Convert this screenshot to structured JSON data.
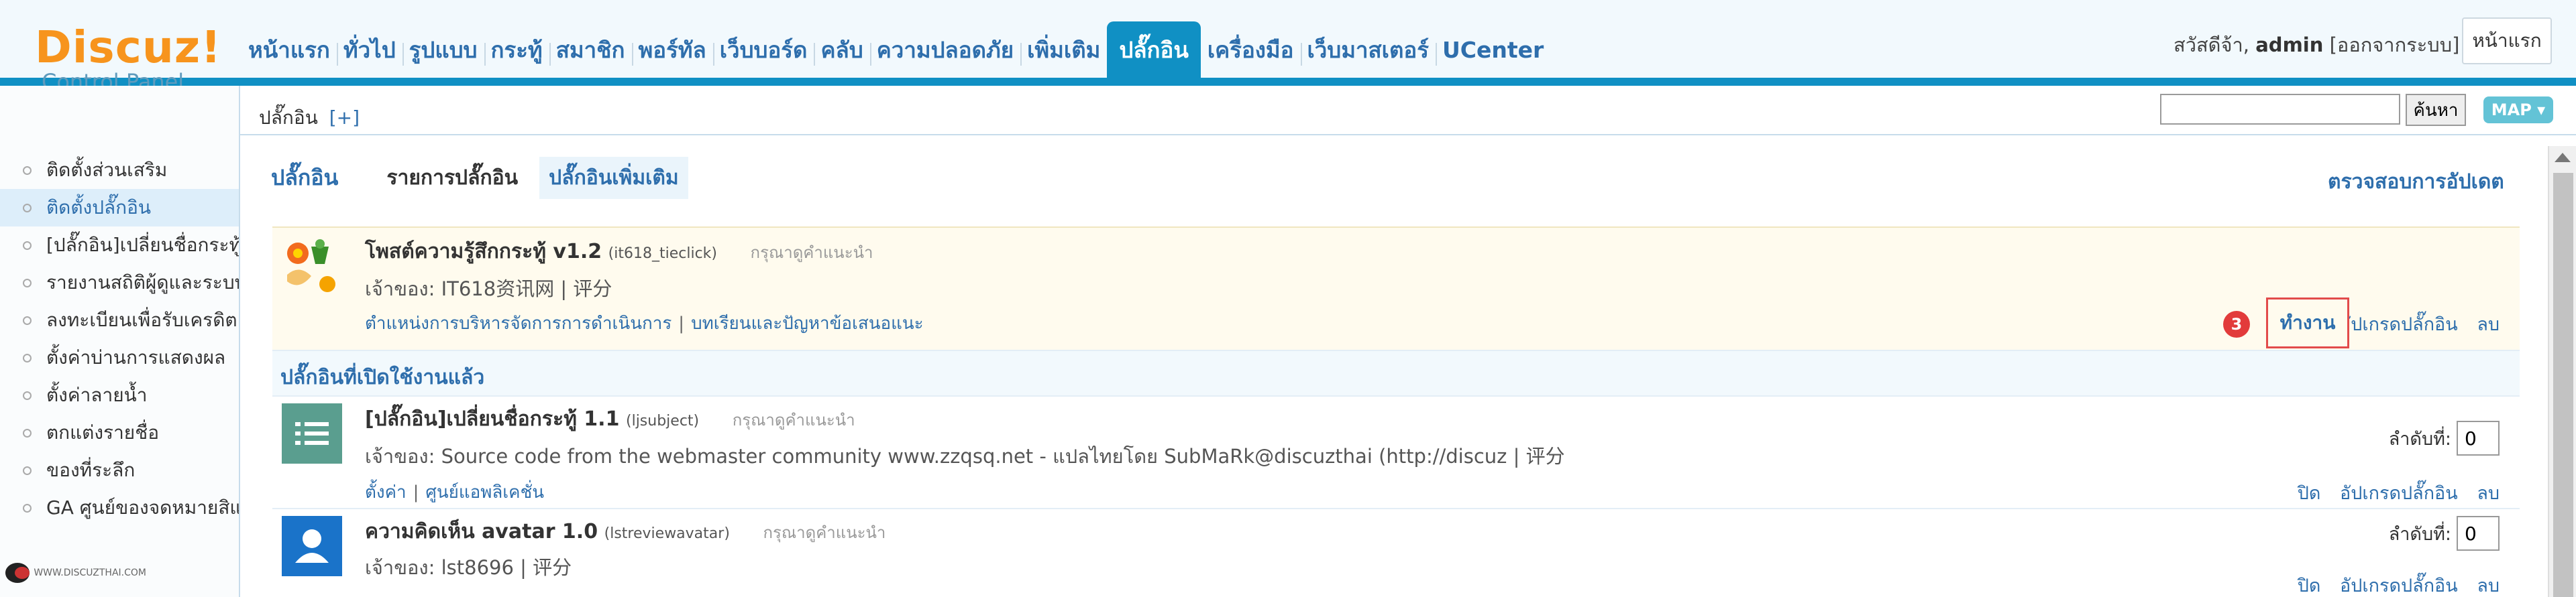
{
  "logo": {
    "line1": "Discuz!",
    "line2": "Control Panel"
  },
  "topnav": [
    {
      "label": "หน้าแรก"
    },
    {
      "label": "ทั่วไป"
    },
    {
      "label": "รูปแบบ"
    },
    {
      "label": "กระทู้"
    },
    {
      "label": "สมาชิก"
    },
    {
      "label": "พอร์ทัล"
    },
    {
      "label": "เว็บบอร์ด"
    },
    {
      "label": "คลับ"
    },
    {
      "label": "ความปลอดภัย"
    },
    {
      "label": "เพิ่มเติม"
    },
    {
      "label": "ปลั๊กอิน",
      "active": true
    },
    {
      "label": "เครื่องมือ"
    },
    {
      "label": "เว็บมาสเตอร์"
    },
    {
      "label": "UCenter"
    }
  ],
  "user": {
    "greeting": "สวัสดีจ้า,",
    "name": "admin",
    "logout": "[ออกจากระบบ]",
    "home_button": "หน้าแรก"
  },
  "breadcrumb": {
    "label": "ปลั๊กอิน",
    "plus": "[+]"
  },
  "search": {
    "button": "ค้นหา",
    "map": "MAP ▾"
  },
  "sidebar": {
    "items": [
      {
        "label": "ติดตั้งส่วนเสริม"
      },
      {
        "label": "ติดตั้งปลั๊กอิน",
        "active": true
      },
      {
        "label": "[ปลั๊กอิน]เปลี่ยนชื่อกระทู้"
      },
      {
        "label": "รายงานสถิติผู้ดูและระบบ"
      },
      {
        "label": "ลงทะเบียนเพื่อรับเครดิต"
      },
      {
        "label": "ตั้งค่าบ่านการแสดงผล"
      },
      {
        "label": "ตั้งค่าลายน้ำ"
      },
      {
        "label": "ตกแต่งรายชื่อ"
      },
      {
        "label": "ของที่ระลึก"
      },
      {
        "label": "GA ศูนย์ของจดหมายสิแนะ"
      }
    ],
    "footer": "WWW.DISCUZTHAI.COM"
  },
  "main": {
    "title": "ปลั๊กอิน",
    "tabs": [
      {
        "label": "รายการปลั๊กอิน"
      },
      {
        "label": "ปลั๊กอินเพิ่มเติม",
        "active": true
      }
    ],
    "check_update": "ตรวจสอบการอัปเดต",
    "section_enabled": "ปลั๊กอินที่เปิดใช้งานแล้ว",
    "plugins": [
      {
        "name": "โพสต์ความรู้สึกกระทู้ v1.2",
        "id": "(it618_tieclick)",
        "note": "กรุณาดูคำแนะนำ",
        "owner": "เจ้าของ: IT618资讯网 | 评分",
        "links": [
          "ตำแหน่งการบริหารจัดการการดำเนินการ",
          "บทเรียนและปัญหาข้อเสนอแนะ"
        ],
        "actions": [
          "ทำงาน",
          "อัปเกรดปลั๊กอิน",
          "ลบ"
        ],
        "badge": "3"
      },
      {
        "name": "[ปลั๊กอิน]เปลี่ยนชื่อกระทู้ 1.1",
        "id": "(ljsubject)",
        "note": "กรุณาดูคำแนะนำ",
        "owner": "เจ้าของ: Source code from the webmaster community www.zzqsq.net - แปลไทยโดย SubMaRk@discuzthai (http://discuz | 评分",
        "links": [
          "ตั้งค่า",
          "ศูนย์แอพลิเคชั่น"
        ],
        "order_label": "ลำดับที่:",
        "order_value": "0",
        "actions": [
          "ปิด",
          "อัปเกรดปลั๊กอิน",
          "ลบ"
        ]
      },
      {
        "name": "ความคิดเห็น avatar 1.0",
        "id": "(lstreviewavatar)",
        "note": "กรุณาดูคำแนะนำ",
        "owner": "เจ้าของ: lst8696 | 评分",
        "order_label": "ลำดับที่:",
        "order_value": "0",
        "actions": [
          "ปิด",
          "อัปเกรดปลั๊กอิน",
          "ลบ"
        ]
      }
    ]
  },
  "colors": {
    "accent": "#1090c4",
    "link": "#2e6eac",
    "logo": "#f7941d",
    "highlight": "#fffbee",
    "badge": "#e23b3b"
  }
}
